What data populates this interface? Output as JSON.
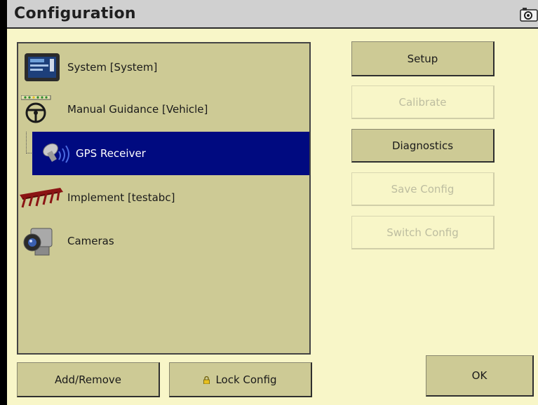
{
  "window": {
    "title": "Configuration"
  },
  "tree": {
    "items": [
      {
        "label": "System [System]",
        "icon": "display-terminal-icon"
      },
      {
        "label": "Manual Guidance [Vehicle]",
        "icon": "steering-wheel-icon"
      },
      {
        "label": "GPS Receiver",
        "icon": "gps-antenna-icon",
        "selected": true
      },
      {
        "label": "Implement [testabc]",
        "icon": "implement-plow-icon"
      },
      {
        "label": "Cameras",
        "icon": "camera-icon"
      }
    ]
  },
  "actions": {
    "setup": "Setup",
    "calibrate": "Calibrate",
    "diagnostics": "Diagnostics",
    "save_config": "Save Config",
    "switch_config": "Switch Config"
  },
  "footer": {
    "add_remove": "Add/Remove",
    "lock_config": "Lock Config",
    "ok": "OK"
  },
  "colors": {
    "background": "#f8f6c8",
    "panel": "#cdca95",
    "selection": "#000a80",
    "disabled_text": "#bdbda0"
  }
}
